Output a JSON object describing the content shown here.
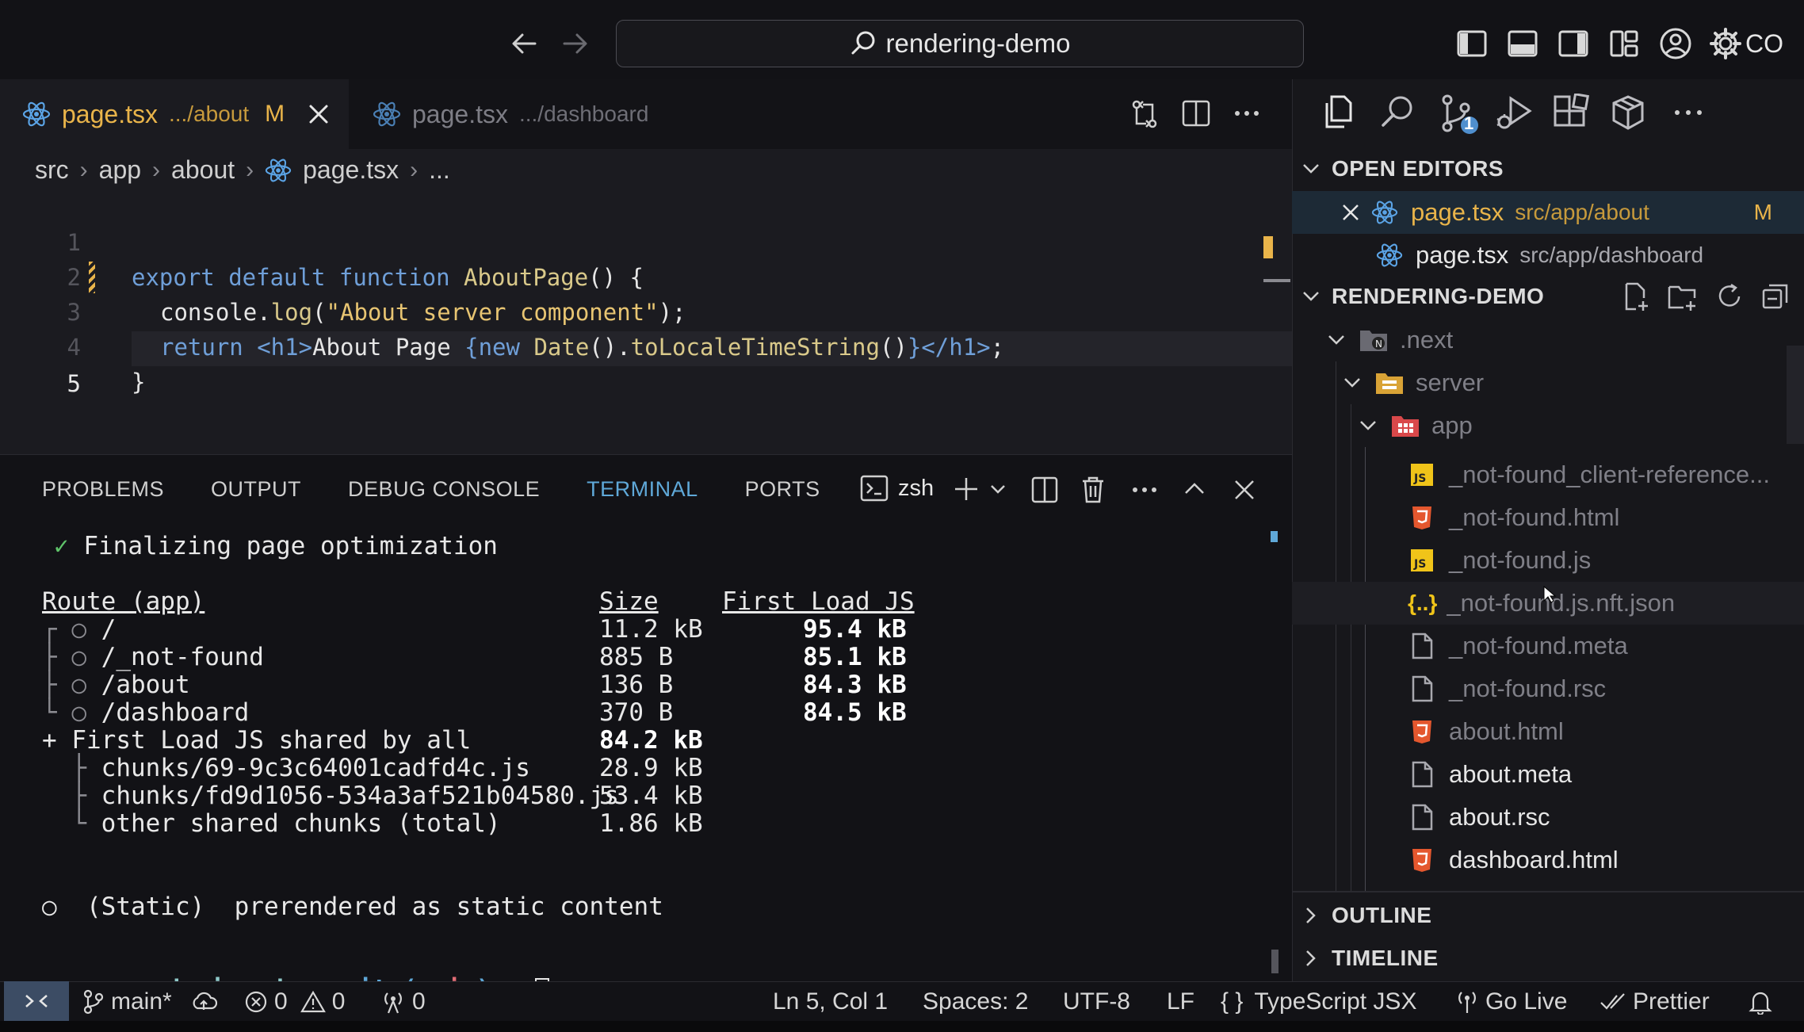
{
  "window": {
    "search_text": "rendering-demo",
    "account_label": "CO"
  },
  "tabs": [
    {
      "name": "page.tsx",
      "path": ".../about",
      "status": "M"
    },
    {
      "name": "page.tsx",
      "path": ".../dashboard"
    }
  ],
  "breadcrumb": [
    "src",
    "app",
    "about",
    "page.tsx",
    "..."
  ],
  "editor": {
    "line_numbers": [
      "1",
      "2",
      "3",
      "4",
      "5"
    ],
    "lines": [
      {
        "kw1": "export default function ",
        "fn": "AboutPage",
        "rest": "() {"
      },
      {
        "obj": "console",
        "dot": ".",
        "fn": "log",
        "open": "(",
        "str": "\"About server component\"",
        "close": ");"
      },
      {
        "kw": "return ",
        "tag_open": "<h1>",
        "text": "About Page ",
        "brace": "{",
        "expr_kw": "new ",
        "expr_fn": "Date",
        "expr_rest": "().",
        "expr_fn2": "toLocaleTimeString",
        "expr_end": "()",
        "brace_close": "}",
        "tag_close": "</h1>",
        "semi": ";"
      },
      {
        "text": "}"
      },
      {
        "text": ""
      }
    ]
  },
  "panel": {
    "tabs": [
      "PROBLEMS",
      "OUTPUT",
      "DEBUG CONSOLE",
      "TERMINAL",
      "PORTS"
    ],
    "active_tab": "TERMINAL",
    "shell": "zsh"
  },
  "terminal": {
    "finalizing": "Finalizing page optimization",
    "check": "✓",
    "header": {
      "route": "Route (app)",
      "size": "Size",
      "first_load": "First Load JS"
    },
    "routes": [
      {
        "prefix": "┌ ○ ",
        "route": "/",
        "size": "11.2 kB",
        "first_load": "95.4 kB"
      },
      {
        "prefix": "├ ○ ",
        "route": "/_not-found",
        "size": "885 B",
        "first_load": "85.1 kB"
      },
      {
        "prefix": "├ ○ ",
        "route": "/about",
        "size": "136 B",
        "first_load": "84.3 kB"
      },
      {
        "prefix": "└ ○ ",
        "route": "/dashboard",
        "size": "370 B",
        "first_load": "84.5 kB"
      }
    ],
    "shared": {
      "label": "+ First Load JS shared by all",
      "size": "84.2 kB"
    },
    "chunks": [
      {
        "prefix": "  ├ ",
        "name": "chunks/69-9c3c64001cadfd4c.js",
        "size": "28.9 kB"
      },
      {
        "prefix": "  ├ ",
        "name": "chunks/fd9d1056-534a3af521b04580.js",
        "size": "53.4 kB"
      },
      {
        "prefix": "  └ ",
        "name": "other shared chunks (total)",
        "size": "1.86 kB"
      }
    ],
    "legend": "○  (Static)  prerendered as static content",
    "prompt": {
      "arrow": "→",
      "dir": "rendering-demo",
      "git": "git:(",
      "branch": "main",
      "git_close": ")",
      "dirty": "✗"
    }
  },
  "sidebar": {
    "open_editors_title": "OPEN EDITORS",
    "open_editors": [
      {
        "name": "page.tsx",
        "path": "src/app/about",
        "status": "M"
      },
      {
        "name": "page.tsx",
        "path": "src/app/dashboard"
      }
    ],
    "project_title": "RENDERING-DEMO",
    "tree": [
      {
        "name": ".next",
        "type": "folder-next",
        "level": 0
      },
      {
        "name": "server",
        "type": "folder",
        "level": 1
      },
      {
        "name": "app",
        "type": "folder-app",
        "level": 2
      },
      {
        "name": "_not-found_client-reference...",
        "type": "js"
      },
      {
        "name": "_not-found.html",
        "type": "html"
      },
      {
        "name": "_not-found.js",
        "type": "js"
      },
      {
        "name": "_not-found.js.nft.json",
        "type": "json"
      },
      {
        "name": "_not-found.meta",
        "type": "file"
      },
      {
        "name": "_not-found.rsc",
        "type": "file"
      },
      {
        "name": "about.html",
        "type": "html"
      },
      {
        "name": "about.meta",
        "type": "file"
      },
      {
        "name": "about.rsc",
        "type": "file"
      },
      {
        "name": "dashboard.html",
        "type": "html"
      }
    ],
    "outline_title": "OUTLINE",
    "timeline_title": "TIMELINE",
    "scm_badge": "1"
  },
  "statusbar": {
    "branch": "main*",
    "errors": "0",
    "warnings": "0",
    "ports": "0",
    "cursor": "Ln 5, Col 1",
    "spaces": "Spaces: 2",
    "encoding": "UTF-8",
    "eol": "LF",
    "braces": "{ }",
    "language": "TypeScript JSX",
    "golive": "Go Live",
    "prettier": "Prettier"
  },
  "colors": {
    "accent": "#5fa8d8",
    "modified": "#e9b44a",
    "react_icon": "#5ba4e6",
    "html_icon": "#e4572e",
    "js_icon": "#f0c419"
  }
}
